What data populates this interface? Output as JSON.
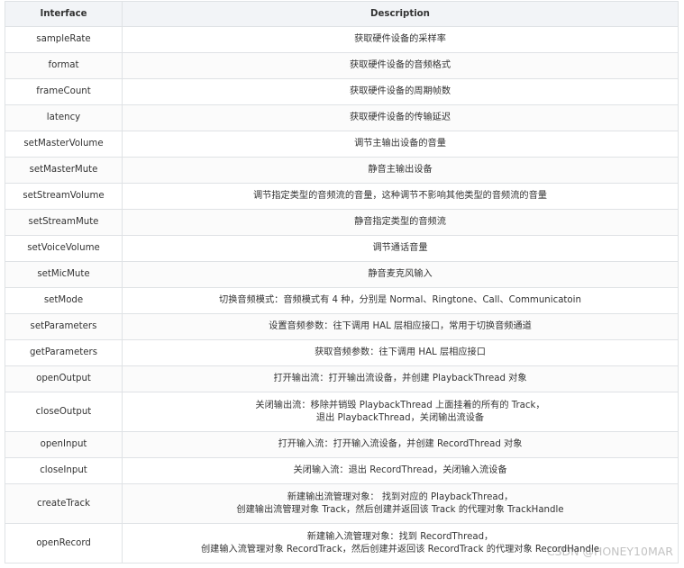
{
  "table": {
    "headers": [
      "Interface",
      "Description"
    ],
    "rows": [
      {
        "interface": "sampleRate",
        "description": [
          "获取硬件设备的采样率"
        ]
      },
      {
        "interface": "format",
        "description": [
          "获取硬件设备的音频格式"
        ]
      },
      {
        "interface": "frameCount",
        "description": [
          "获取硬件设备的周期帧数"
        ]
      },
      {
        "interface": "latency",
        "description": [
          "获取硬件设备的传输延迟"
        ]
      },
      {
        "interface": "setMasterVolume",
        "description": [
          "调节主输出设备的音量"
        ]
      },
      {
        "interface": "setMasterMute",
        "description": [
          "静音主输出设备"
        ]
      },
      {
        "interface": "setStreamVolume",
        "description": [
          "调节指定类型的音频流的音量，这种调节不影响其他类型的音频流的音量"
        ]
      },
      {
        "interface": "setStreamMute",
        "description": [
          "静音指定类型的音频流"
        ]
      },
      {
        "interface": "setVoiceVolume",
        "description": [
          "调节通话音量"
        ]
      },
      {
        "interface": "setMicMute",
        "description": [
          "静音麦克风输入"
        ]
      },
      {
        "interface": "setMode",
        "description": [
          "切换音频模式：音频模式有 4 种，分别是 Normal、Ringtone、Call、Communicatoin"
        ]
      },
      {
        "interface": "setParameters",
        "description": [
          "设置音频参数：往下调用 HAL 层相应接口，常用于切换音频通道"
        ]
      },
      {
        "interface": "getParameters",
        "description": [
          "获取音频参数：往下调用 HAL 层相应接口"
        ]
      },
      {
        "interface": "openOutput",
        "description": [
          "打开输出流：打开输出流设备，并创建 PlaybackThread 对象"
        ]
      },
      {
        "interface": "closeOutput",
        "description": [
          "关闭输出流：移除并销毁 PlaybackThread 上面挂着的所有的 Track，",
          "退出 PlaybackThread，关闭输出流设备"
        ]
      },
      {
        "interface": "openInput",
        "description": [
          "打开输入流：打开输入流设备，并创建 RecordThread 对象"
        ]
      },
      {
        "interface": "closeInput",
        "description": [
          "关闭输入流：退出 RecordThread，关闭输入流设备"
        ]
      },
      {
        "interface": "createTrack",
        "description": [
          "新建输出流管理对象： 找到对应的 PlaybackThread，",
          "创建输出流管理对象 Track，然后创建并返回该 Track 的代理对象 TrackHandle"
        ]
      },
      {
        "interface": "openRecord",
        "description": [
          "新建输入流管理对象：找到 RecordThread，",
          "创建输入流管理对象 RecordTrack，然后创建并返回该 RecordTrack 的代理对象 RecordHandle"
        ]
      }
    ]
  },
  "watermark": "CSDN @HONEY10MAR"
}
